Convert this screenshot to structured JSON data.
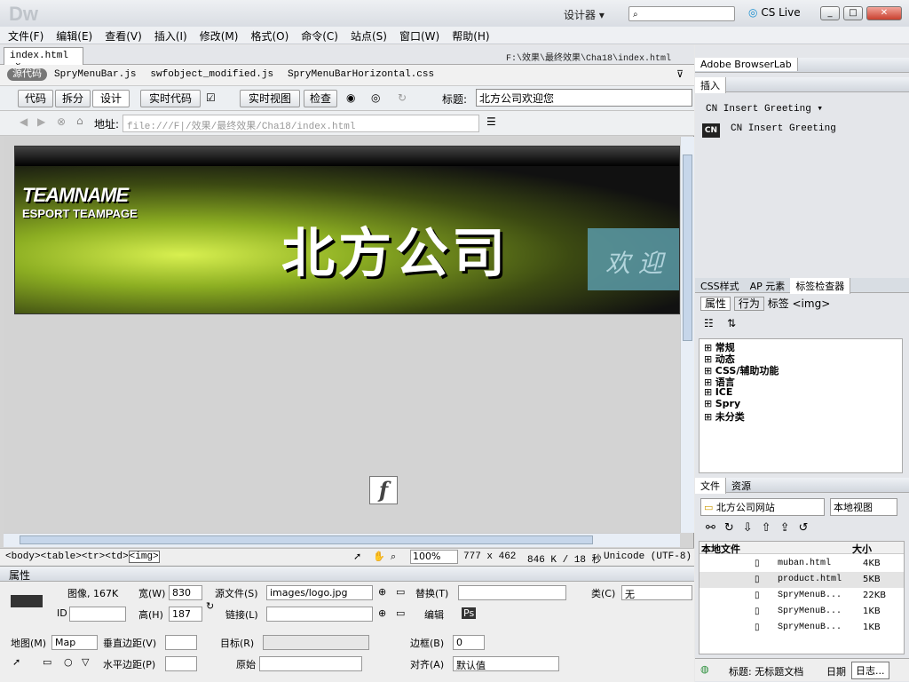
{
  "app": {
    "logo": "Dw",
    "workspace": "设计器",
    "cs_live": "CS Live",
    "btn_min": "_",
    "btn_max": "□",
    "btn_close": "✕"
  },
  "menu": [
    "文件(F)",
    "编辑(E)",
    "查看(V)",
    "插入(I)",
    "修改(M)",
    "格式(O)",
    "命令(C)",
    "站点(S)",
    "窗口(W)",
    "帮助(H)"
  ],
  "document": {
    "tab": "index.html",
    "close_glyph": "×",
    "path": "F:\\效果\\最终效果\\Cha18\\index.html",
    "related_label": "源代码",
    "related_files": [
      "SpryMenuBar.js",
      "swfobject_modified.js",
      "SpryMenuBarHorizontal.css"
    ],
    "toolbar": {
      "code": "代码",
      "split": "拆分",
      "design": "设计",
      "live_code": "实时代码",
      "live_view": "实时视图",
      "inspect": "检查",
      "title_label": "标题:",
      "title_value": "北方公司欢迎您"
    },
    "address_label": "地址:",
    "address_value": "file:///F|/效果/最终效果/Cha18/index.html",
    "banner": {
      "teamname": "TEAMNAME",
      "esport": "ESPORT TEAMPAGE",
      "title": "北方公司",
      "welcome": "欢 迎"
    },
    "flash_glyph": "f",
    "status": {
      "breadcrumb": [
        "<body>",
        "<table>",
        "<tr>",
        "<td>",
        "<img>"
      ],
      "zoom": "100%",
      "size": "777 x 462",
      "weight": "846 K / 18 秒",
      "encoding": "Unicode (UTF-8)"
    }
  },
  "properties": {
    "title": "属性",
    "image_label": "图像, 167K",
    "width_label": "宽(W)",
    "width": "830",
    "height_label": "高(H)",
    "height": "187",
    "src_label": "源文件(S)",
    "src": "images/logo.jpg",
    "alt_label": "替换(T)",
    "class_label": "类(C)",
    "class_value": "无",
    "id_label": "ID",
    "link_label": "链接(L)",
    "edit_label": "编辑",
    "map_label": "地图(M)",
    "map_value": "Map",
    "vspace_label": "垂直边距(V)",
    "hspace_label": "水平边距(P)",
    "target_label": "目标(R)",
    "original_label": "原始",
    "border_label": "边框(B)",
    "border": "0",
    "align_label": "对齐(A)",
    "align_value": "默认值"
  },
  "right_panel": {
    "browserlab": "Adobe BrowserLab",
    "insert": "插入",
    "insert_category": "CN Insert Greeting",
    "insert_item": "CN Insert Greeting",
    "insert_icon_text": "CN",
    "tabs": [
      "CSS样式",
      "AP 元素",
      "标签检查器"
    ],
    "subtabs": [
      "属性",
      "行为"
    ],
    "tag_label": "标签 <img>",
    "tree": [
      "常规",
      "动态",
      "CSS/辅助功能",
      "语言",
      "ICE",
      "Spry",
      "未分类"
    ],
    "files_tabs": [
      "文件",
      "资源"
    ],
    "site": "北方公司网站",
    "view": "本地视图",
    "col_local": "本地文件",
    "col_size": "大小",
    "files": [
      {
        "name": "muban.html",
        "size": "4KB"
      },
      {
        "name": "product.html",
        "size": "5KB"
      },
      {
        "name": "SpryMenuB...",
        "size": "22KB"
      },
      {
        "name": "SpryMenuB...",
        "size": "1KB"
      },
      {
        "name": "SpryMenuB...",
        "size": "1KB"
      }
    ],
    "footer_title": "标题: 无标题文档",
    "footer_date": "日期",
    "footer_log": "日志..."
  }
}
